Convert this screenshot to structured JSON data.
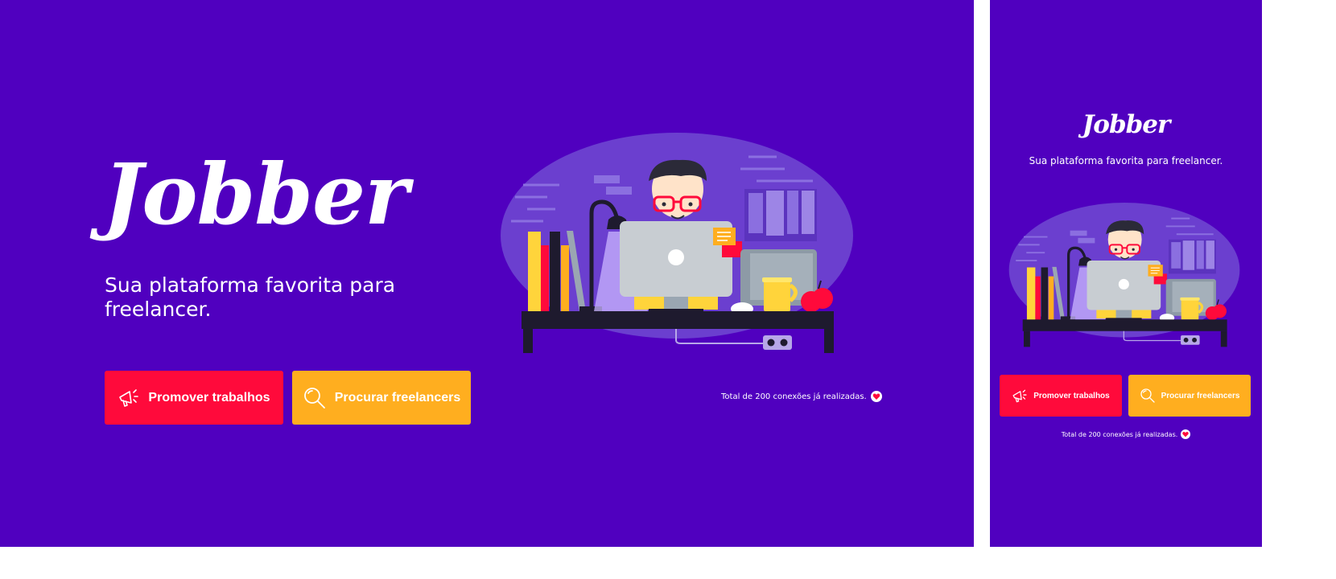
{
  "brand": {
    "name": "Jobber"
  },
  "tagline": "Sua plataforma favorita para freelancer.",
  "buttons": {
    "promote": {
      "label": "Promover trabalhos",
      "icon": "megaphone-icon",
      "color": "#FF0A3B"
    },
    "search": {
      "label": "Procurar freelancers",
      "icon": "magnifier-icon",
      "color": "#FFAE1F"
    }
  },
  "stats": {
    "text": "Total de 200 conexões já realizadas.",
    "icon": "heart-icon"
  },
  "colors": {
    "background": "#5000BF",
    "text": "#FFFFFF",
    "illustration_blob": "#6B3FCF"
  },
  "illustration": {
    "name": "freelancer-at-desk-illustration"
  }
}
